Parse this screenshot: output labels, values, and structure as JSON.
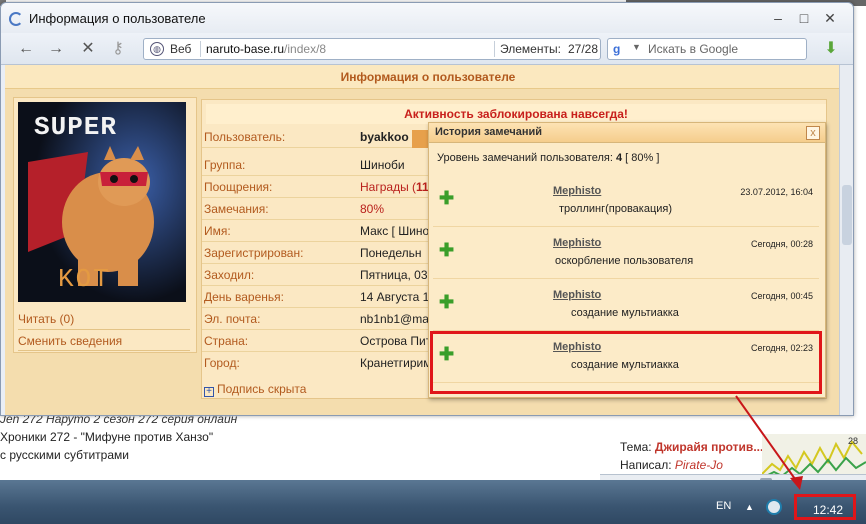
{
  "background": {
    "news_lines": [
      "Jen 272 Наруто 2 сезон 272 серия онлайн",
      "Хроники 272 - \"Мифуне против Ханзо\"",
      " с русскими субтитрами"
    ],
    "forum": {
      "topic_label": "Тема: ",
      "topic_value": "Джирайя против...",
      "author_label": "Написал: ",
      "author_value": "Pirate-Jo"
    },
    "graph_label": "28"
  },
  "window": {
    "title": "Информация о пользователе",
    "controls": {
      "min": "–",
      "max": "□",
      "close": "✕"
    }
  },
  "toolbar": {
    "back": "←",
    "forward": "→",
    "stop": "✕",
    "key": "⚷",
    "web_label": "Веб",
    "url_host": "naruto-base.ru",
    "url_path": "/index/8",
    "elements_label": "Элементы:",
    "elements_count": "27/28",
    "search_engine_letter": "g",
    "search_placeholder": "Искать в Google",
    "download_icon": "⬇"
  },
  "page": {
    "header": "Информация о пользователе",
    "avatar": {
      "top_text": "SUPER",
      "bottom_text": "KOT"
    },
    "left_links": {
      "read": "Читать (0)",
      "change": "Сменить сведения"
    },
    "banner": "Активность заблокирована навсегда!",
    "rows": [
      {
        "key": "Пользователь:",
        "value": "byakkoo"
      },
      {
        "key": "Группа:",
        "value": "Шиноби"
      },
      {
        "key": "Поощрения:",
        "value": "Награды (",
        "extra": "11"
      },
      {
        "key": "Замечания:",
        "value": "80%"
      },
      {
        "key": "Имя:",
        "value": "Макс [ Шино"
      },
      {
        "key": "Зарегистрирован:",
        "value": "Понедельн"
      },
      {
        "key": "Заходил:",
        "value": "Пятница, 03"
      },
      {
        "key": "День варенья:",
        "value": "14 Августа 19"
      },
      {
        "key": "Эл. почта:",
        "value": "nb1nb1@ma"
      },
      {
        "key": "Страна:",
        "value": "Острова Пит"
      },
      {
        "key": "Город:",
        "value": "Кранетгирима"
      }
    ],
    "signature_toggle": "Подпись скрыта"
  },
  "popup": {
    "title": "История замечаний",
    "close": "x",
    "level_label": "Уровень замечаний пользователя: ",
    "level_value": "4",
    "level_percent": " [ 80% ]",
    "warnings": [
      {
        "who": "Mephisto",
        "when": "23.07.2012, 16:04",
        "why": "троллинг(провакация)"
      },
      {
        "who": "Mephisto",
        "when": "Сегодня, 00:28",
        "why": "оскорбление пользователя"
      },
      {
        "who": "Mephisto",
        "when": "Сегодня, 00:45",
        "why": "создание мультиакка"
      },
      {
        "who": "Mephisto",
        "when": "Сегодня, 02:23",
        "why": "создание мультиакка"
      }
    ]
  },
  "taskbar": {
    "language": "EN",
    "tray_arrow": "▲",
    "clock": "12:42"
  },
  "colors": {
    "accent_text": "#b25a1e",
    "banner_red": "#c8201c",
    "highlight_red": "#e0161a",
    "plus_green": "#3a9e2a",
    "page_bg": "#f4ddae"
  }
}
